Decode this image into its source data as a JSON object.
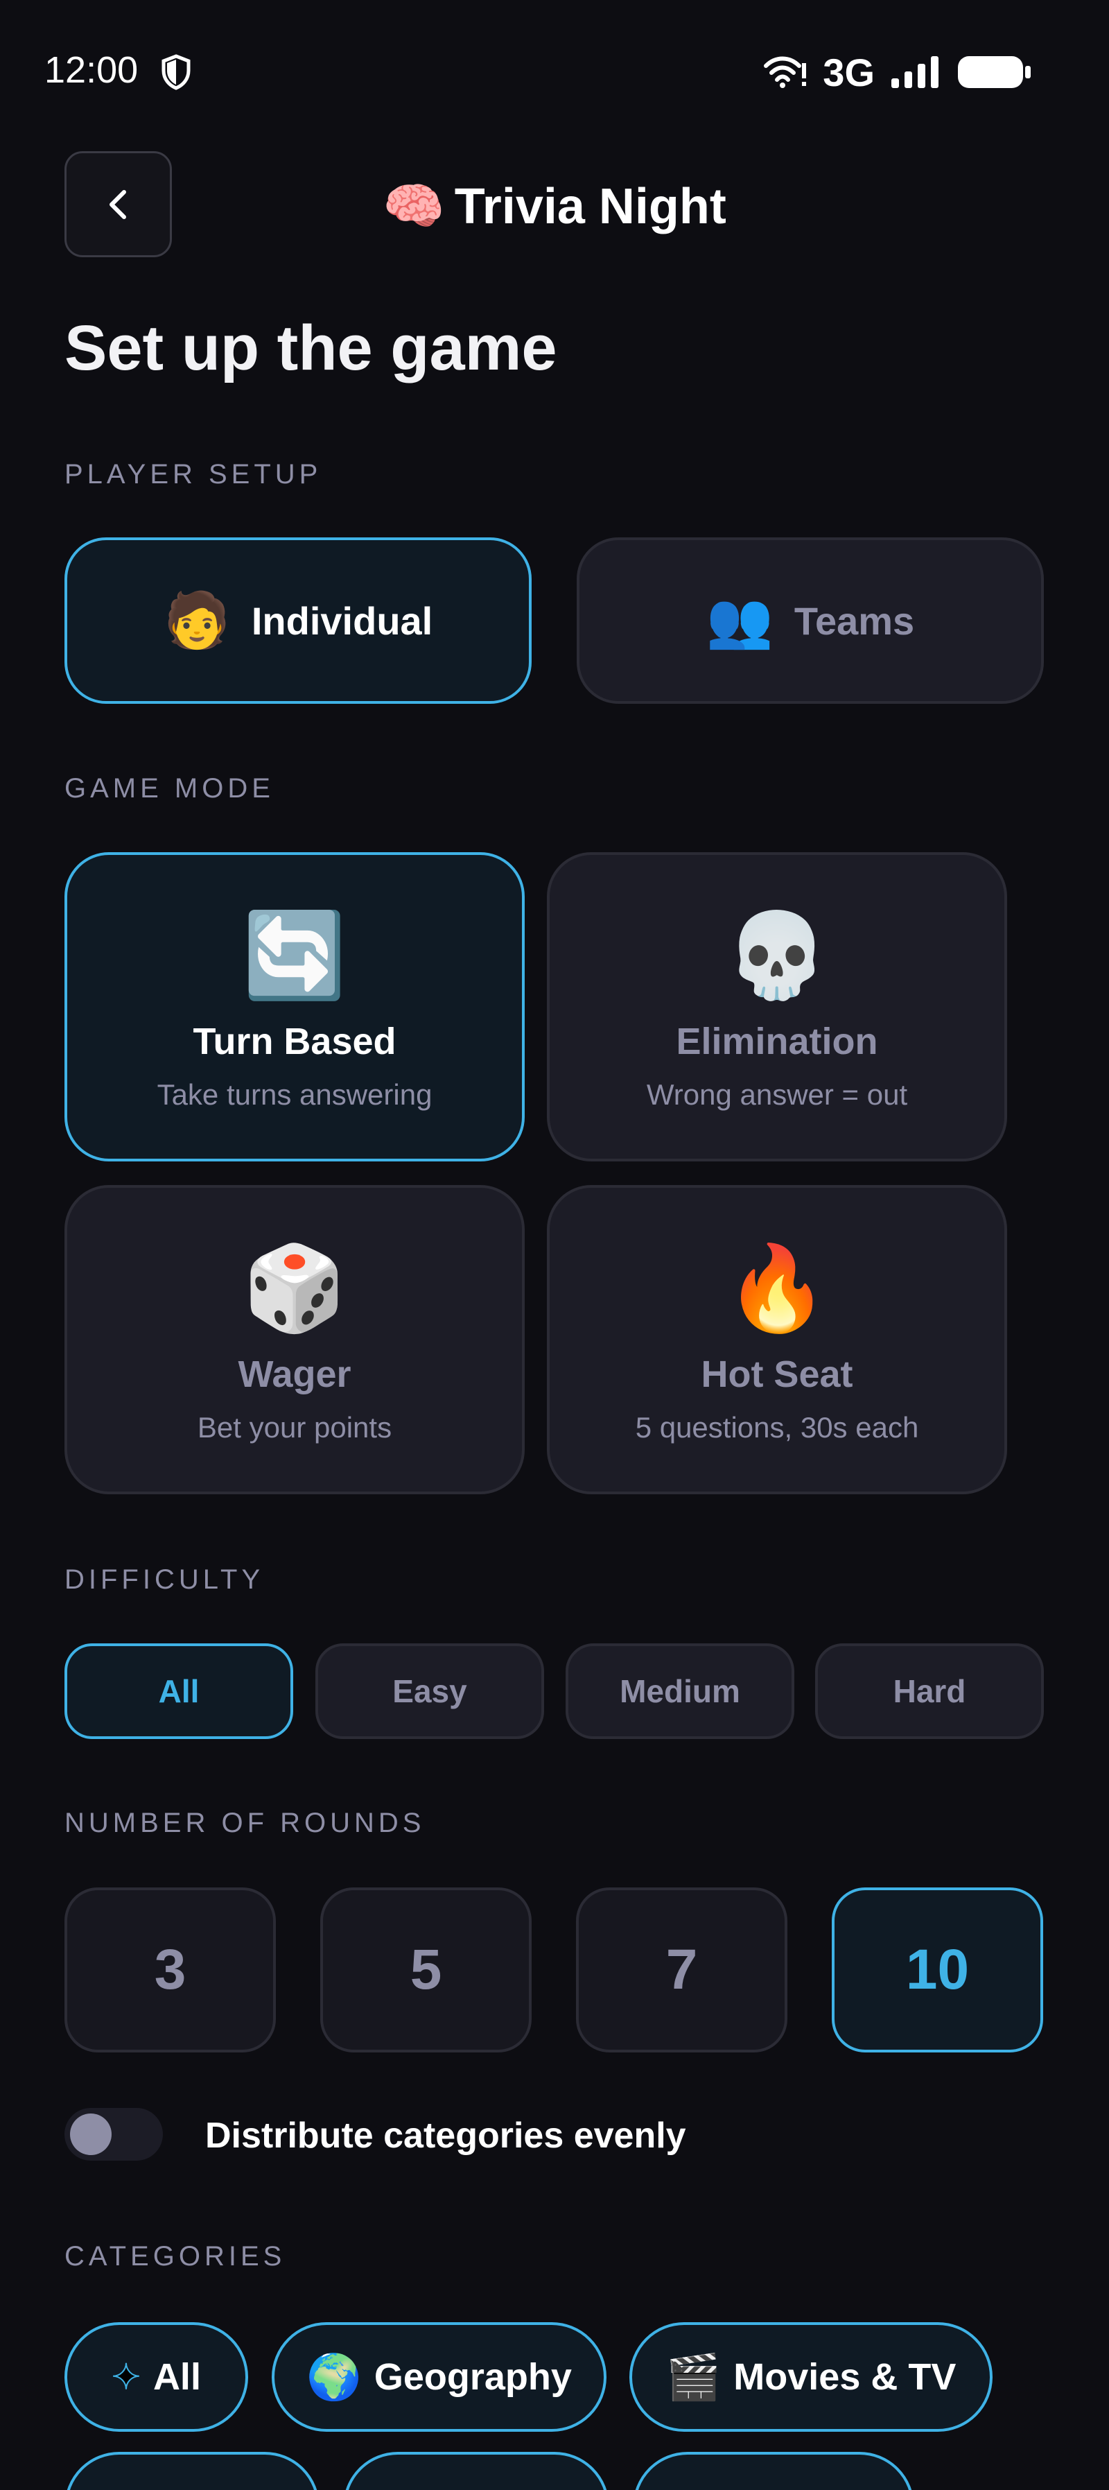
{
  "status_bar": {
    "time": "12:00",
    "network": "3G",
    "icons": [
      "shield-icon",
      "wifi-icon",
      "signal-icon",
      "battery-icon"
    ]
  },
  "header": {
    "back_icon": "chevron-left-icon",
    "title_emoji": "🧠",
    "title": "Trivia Night"
  },
  "page_title": "Set up the game",
  "player_setup": {
    "label": "PLAYER SETUP",
    "options": [
      {
        "emoji": "🧑",
        "label": "Individual",
        "selected": true
      },
      {
        "emoji": "👥",
        "label": "Teams",
        "selected": false
      }
    ]
  },
  "game_mode": {
    "label": "GAME MODE",
    "modes": [
      {
        "emoji": "🔄",
        "title": "Turn Based",
        "desc": "Take turns answering",
        "selected": true
      },
      {
        "emoji": "💀",
        "title": "Elimination",
        "desc": "Wrong answer = out",
        "selected": false
      },
      {
        "emoji": "🎲",
        "title": "Wager",
        "desc": "Bet your points",
        "selected": false
      },
      {
        "emoji": "🔥",
        "title": "Hot Seat",
        "desc": "5 questions, 30s each",
        "selected": false
      }
    ]
  },
  "difficulty": {
    "label": "DIFFICULTY",
    "options": [
      "All",
      "Easy",
      "Medium",
      "Hard"
    ],
    "selected": "All"
  },
  "rounds": {
    "label": "NUMBER OF ROUNDS",
    "options": [
      "3",
      "5",
      "7",
      "10"
    ],
    "selected": "10"
  },
  "distribute": {
    "label": "Distribute categories evenly",
    "enabled": false
  },
  "categories": {
    "label": "CATEGORIES",
    "chips": [
      {
        "emoji": "✦",
        "label": "All"
      },
      {
        "emoji": "🌍",
        "label": "Geography"
      },
      {
        "emoji": "🎬",
        "label": "Movies & TV"
      }
    ]
  },
  "colors": {
    "background": "#0d0d12",
    "card": "#1c1c26",
    "accent": "#3fb2e6",
    "muted_text": "#8e8ea6"
  }
}
